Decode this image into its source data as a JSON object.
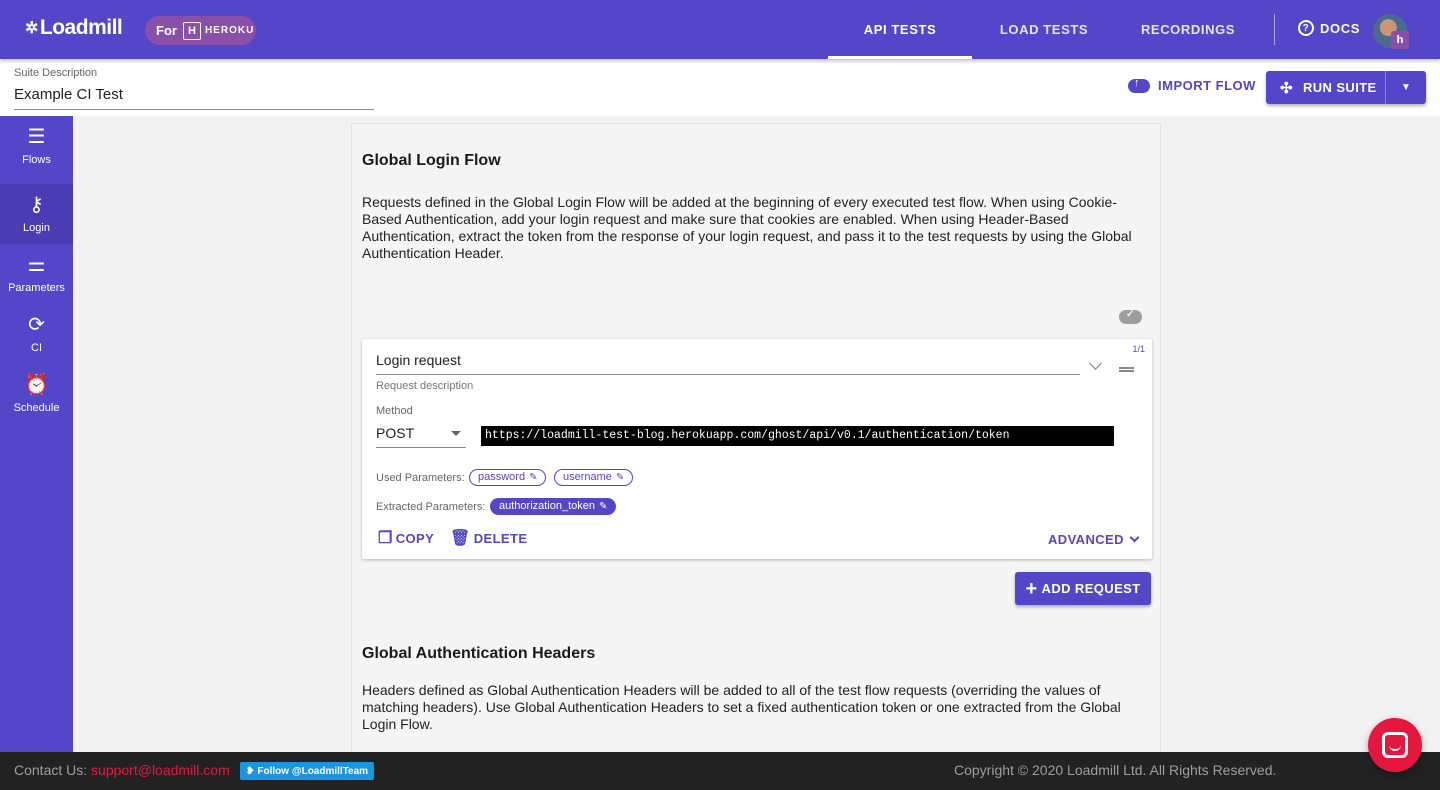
{
  "header": {
    "logo_text": "Loadmill",
    "heroku_for": "For",
    "heroku_mark": "H",
    "heroku_word": "HEROKU",
    "tabs": [
      {
        "label": "API TESTS"
      },
      {
        "label": "LOAD TESTS"
      },
      {
        "label": "RECORDINGS"
      }
    ],
    "active_tab": "API TESTS",
    "docs_label": "DOCS",
    "avatar_badge": "h"
  },
  "suite": {
    "label": "Suite Description",
    "value": "Example CI Test",
    "import_label": "IMPORT FLOW",
    "run_label": "RUN SUITE"
  },
  "sidebar": {
    "items": [
      {
        "label": "Flows",
        "icon": "list-icon",
        "glyph": "☰"
      },
      {
        "label": "Login",
        "icon": "key-icon",
        "glyph": "⚷"
      },
      {
        "label": "Parameters",
        "icon": "sliders-icon",
        "glyph": "⚌"
      },
      {
        "label": "CI",
        "icon": "sync-icon",
        "glyph": "⟳"
      },
      {
        "label": "Schedule",
        "icon": "alarm-icon",
        "glyph": "⏰"
      }
    ],
    "active": "Login"
  },
  "login_flow": {
    "title": "Global Login Flow",
    "description": "Requests defined in the Global Login Flow will be added at the beginning of every executed test flow. When using Cookie-Based Authentication, add your login request and make sure that cookies are enabled. When using Header-Based Authentication, extract the token from the response of your login request, and pass it to the test requests by using the Global Authentication Header.",
    "request": {
      "counter": "1/1",
      "name": "Login request",
      "description_placeholder": "Request description",
      "method_label": "Method",
      "method": "POST",
      "url": "https://loadmill-test-blog.herokuapp.com/ghost/api/v0.1/authentication/token",
      "used_params_label": "Used Parameters:",
      "used_params": [
        "password",
        "username"
      ],
      "extracted_params_label": "Extracted Parameters:",
      "extracted_params": [
        "authorization_token"
      ],
      "copy_label": "COPY",
      "delete_label": "DELETE",
      "advanced_label": "ADVANCED"
    },
    "add_request_label": "ADD REQUEST"
  },
  "auth_headers": {
    "title": "Global Authentication Headers",
    "description": "Headers defined as Global Authentication Headers will be added to all of the test flow requests (overriding the values of matching headers). Use Global Authentication Headers to set a fixed authentication token or one extracted from the Global Login Flow."
  },
  "footer": {
    "contact_label": "Contact Us:",
    "contact_email": "support@loadmill.com",
    "twitter_label": "Follow @LoadmillTeam",
    "copyright": "Copyright © 2020 Loadmill Ltd. All Rights Reserved."
  },
  "colors": {
    "primary": "#5446c8",
    "heroku": "#8a4fa8",
    "accent_red": "#e5173f",
    "footer_bg": "#222222"
  }
}
